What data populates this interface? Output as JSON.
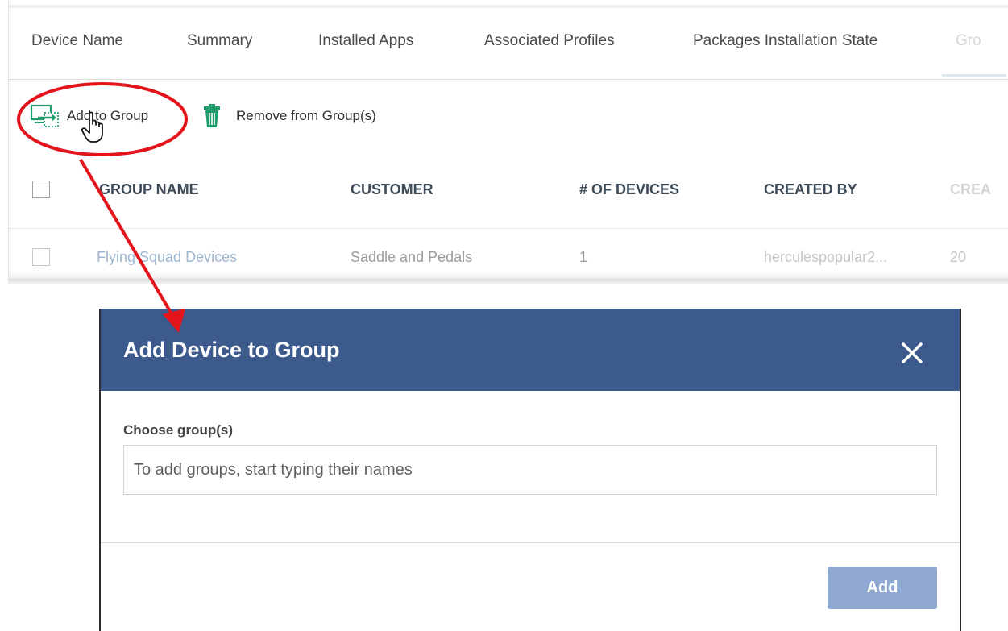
{
  "tabs": [
    {
      "label": "Device Name"
    },
    {
      "label": "Summary"
    },
    {
      "label": "Installed Apps"
    },
    {
      "label": "Associated Profiles"
    },
    {
      "label": "Packages Installation State"
    },
    {
      "label": "Gro"
    }
  ],
  "toolbar": {
    "add_to_group_label": "Add to Group",
    "remove_from_group_label": "Remove from Group(s)"
  },
  "table": {
    "columns": [
      "GROUP NAME",
      "CUSTOMER",
      "# OF DEVICES",
      "CREATED BY",
      "CREA"
    ],
    "rows": [
      {
        "group_name": "Flying Squad Devices",
        "customer": "Saddle and Pedals",
        "devices": "1",
        "created_by": "herculespopular2...",
        "created": "20"
      }
    ]
  },
  "dialog": {
    "title": "Add Device to Group",
    "field_label": "Choose group(s)",
    "input_placeholder": "To add groups, start typing their names",
    "add_button_label": "Add"
  },
  "colors": {
    "dialog_header": "#3c5a8c",
    "add_button": "#8fa9d3",
    "annotation": "#e3141b",
    "link": "#9db6cf",
    "icon_green": "#1f9d6b"
  },
  "icons": [
    "add-to-group-icon",
    "trash-icon",
    "hand-cursor-icon",
    "close-icon"
  ]
}
